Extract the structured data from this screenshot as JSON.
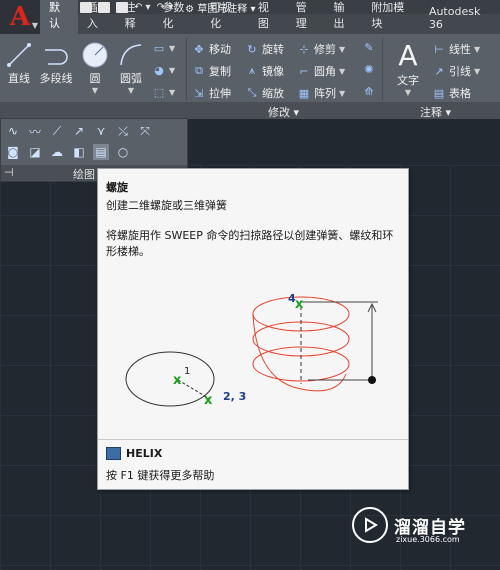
{
  "quick_access": {
    "workspace": "草图与注释"
  },
  "tabs": [
    "默认",
    "插入",
    "注释",
    "参数化",
    "可视化",
    "视图",
    "管理",
    "输出",
    "附加模块",
    "Autodesk 36"
  ],
  "draw_panel": {
    "buttons": [
      "直线",
      "多段线",
      "圆",
      "圆弧"
    ],
    "title": "绘图"
  },
  "modify_panel": {
    "rows": [
      [
        "移动",
        "旋转",
        "修剪"
      ],
      [
        "复制",
        "镜像",
        "圆角"
      ],
      [
        "拉伸",
        "缩放",
        "阵列"
      ]
    ],
    "title": "修改"
  },
  "annotation_panel": {
    "big_button": "文字",
    "items": [
      "线性",
      "引线",
      "表格"
    ],
    "title": "注释"
  },
  "tooltip": {
    "title": "螺旋",
    "subtitle": "创建二维螺旋或三维弹簧",
    "description": "将螺旋用作 SWEEP 命令的扫掠路径以创建弹簧、螺纹和环形楼梯。",
    "labels": {
      "p1": "1",
      "p23": "2, 3",
      "p4": "4"
    },
    "command": "HELIX",
    "help": "按 F1 键获得更多帮助"
  },
  "watermark": {
    "brand": "溜溜自学",
    "url": "zixue.3066.com"
  },
  "colors": {
    "helix": "#e8412c",
    "marker": "#1aa31a"
  }
}
